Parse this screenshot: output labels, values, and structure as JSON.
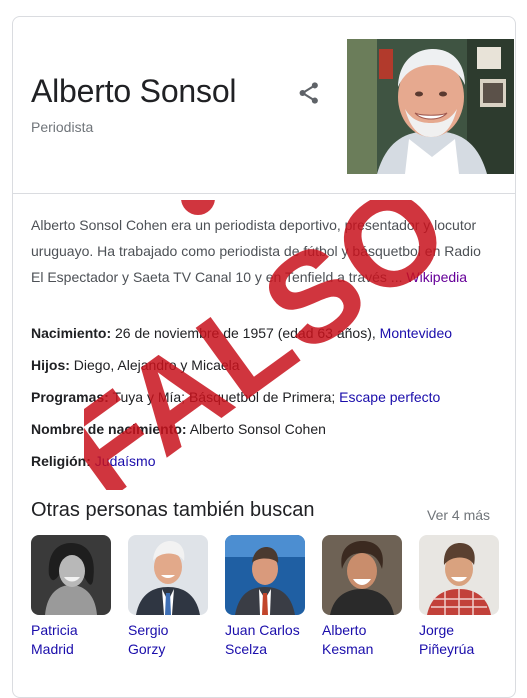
{
  "header": {
    "title": "Alberto Sonsol",
    "subtitle": "Periodista"
  },
  "description": {
    "text": "Alberto Sonsol Cohen era un periodista deportivo, presentador y locutor uruguayo. Ha trabajado como periodista de fútbol y básquetbol en Radio El Espectador y Saeta TV Canal 10 y en Tenfield a través ...",
    "source_link": "Wikipedia"
  },
  "facts": [
    {
      "label": "Nacimiento:",
      "value": "26 de noviembre de 1957 (edad 63 años),",
      "link": "Montevideo"
    },
    {
      "label": "Hijos:",
      "value": "Diego, Alejandro y Micaela",
      "link": ""
    },
    {
      "label": "Programas:",
      "value": "Tuya y Mía; Básquetbol de Primera;",
      "link": "Escape perfecto"
    },
    {
      "label": "Nombre de nacimiento:",
      "value": "Alberto Sonsol Cohen",
      "link": ""
    },
    {
      "label": "Religión:",
      "value": "",
      "link": "Judaísmo"
    }
  ],
  "others": {
    "title": "Otras personas también buscan",
    "more_label": "Ver 4 más",
    "people": [
      {
        "name": "Patricia Madrid"
      },
      {
        "name": "Sergio Gorzy"
      },
      {
        "name": "Juan Carlos Scelza"
      },
      {
        "name": "Alberto Kesman"
      },
      {
        "name": "Jorge Piñeyrúa"
      }
    ]
  },
  "stamp": {
    "text": "FALSO",
    "color": "#c8121c"
  },
  "colors": {
    "link": "#1a0dab",
    "visited_link": "#660099",
    "muted": "#70757a"
  }
}
